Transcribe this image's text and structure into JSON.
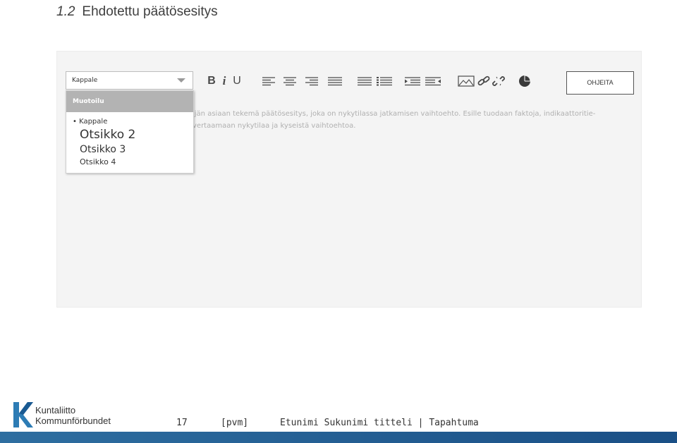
{
  "header": {
    "section_number": "1.2",
    "section_title": "Ehdotettu päätösesitys"
  },
  "editor": {
    "format_select": {
      "selected": "Kappale"
    },
    "format_dropdown": {
      "header": "Muotoilu",
      "items": [
        "• Kappale",
        "Otsikko 2",
        "Otsikko 3",
        "Otsikko 4"
      ]
    },
    "toolbar": {
      "bold": "B",
      "italic": "i",
      "underline": "U",
      "help_button": "OHJEITA"
    },
    "content_lines": [
      "ijän asiaan tekemä päätösesitys, joka on nykytilassa jatkamisen vaihtoehto. Esille tuodaan faktoja, indikaattoritie-",
      "vertaamaan nykytilaa ja kyseistä vaihtoehtoa."
    ]
  },
  "footer": {
    "logo_line1": "Kuntaliitto",
    "logo_line2": "Kommunförbundet",
    "page_number": "17",
    "date": "[pvm]",
    "author": "Etunimi Sukunimi titteli | Tapahtuma"
  },
  "colors": {
    "accent_bar": "#1f5a92",
    "dropdown_header": "#b3b3b3"
  },
  "icons": [
    "align-left-icon",
    "align-center-icon",
    "align-right-icon",
    "align-justify-icon",
    "bullet-list-icon",
    "numbered-list-icon",
    "indent-icon",
    "outdent-icon",
    "image-icon",
    "link-icon",
    "unlink-icon",
    "chart-icon",
    "chevron-down-icon"
  ]
}
